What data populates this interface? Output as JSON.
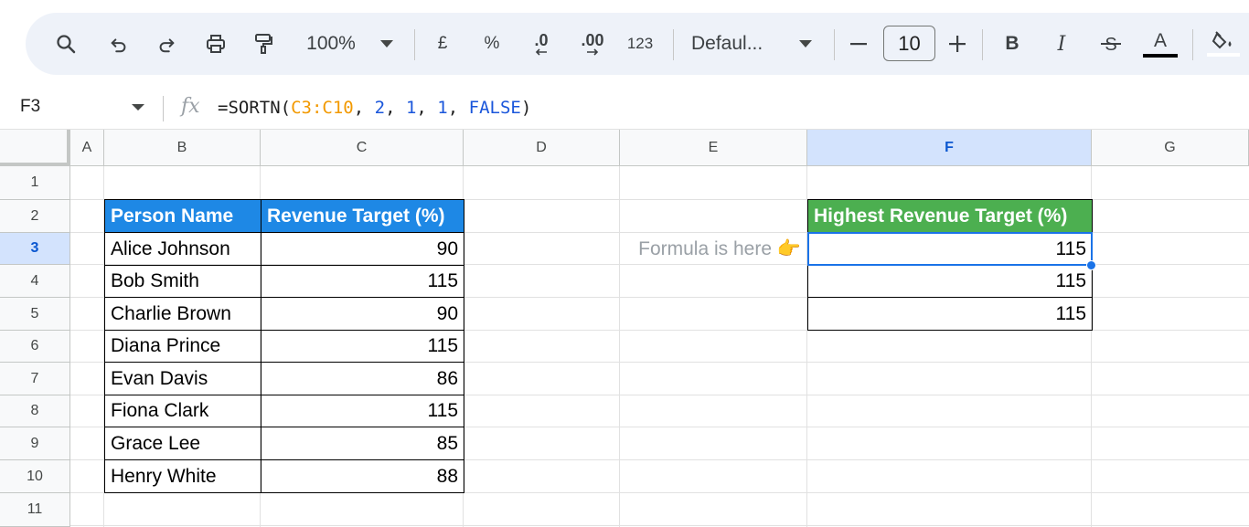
{
  "toolbar": {
    "zoom": "100%",
    "currency": "£",
    "percent": "%",
    "decrease_decimal": ".0",
    "increase_decimal": ".00",
    "number_format": "123",
    "font_name": "Defaul...",
    "font_size": "10",
    "bold": "B",
    "italic": "I",
    "text_color_letter": "A",
    "icons": [
      "search-icon",
      "undo-icon",
      "redo-icon",
      "print-icon",
      "paint-format-icon",
      "minus-icon",
      "plus-icon",
      "strikethrough-icon",
      "fill-color-icon"
    ]
  },
  "formula_bar": {
    "cell_ref": "F3",
    "fx": "fx",
    "formula_prefix": "=SORTN(",
    "formula_range": "C3:C10",
    "formula_sep1": ", ",
    "formula_arg2": "2",
    "formula_sep2": ", ",
    "formula_arg3": "1",
    "formula_sep3": ", ",
    "formula_arg4": "1",
    "formula_sep4": ", ",
    "formula_arg5": "FALSE",
    "formula_suffix": ")"
  },
  "sheet": {
    "columns": [
      "A",
      "B",
      "C",
      "D",
      "E",
      "F",
      "G"
    ],
    "rows": [
      "1",
      "2",
      "3",
      "4",
      "5",
      "6",
      "7",
      "8",
      "9",
      "10",
      "11"
    ],
    "active_column": "F",
    "active_row": "3",
    "table1": {
      "headers": [
        "Person Name",
        "Revenue Target (%)"
      ],
      "rows": [
        [
          "Alice Johnson",
          "90"
        ],
        [
          "Bob Smith",
          "115"
        ],
        [
          "Charlie Brown",
          "90"
        ],
        [
          "Diana Prince",
          "115"
        ],
        [
          "Evan Davis",
          "86"
        ],
        [
          "Fiona Clark",
          "115"
        ],
        [
          "Grace Lee",
          "85"
        ],
        [
          "Henry White",
          "88"
        ]
      ]
    },
    "note": "Formula is here 👉",
    "table2": {
      "header": "Highest Revenue Target (%)",
      "values": [
        "115",
        "115",
        "115"
      ]
    }
  },
  "colors": {
    "header_blue": "#1e88e5",
    "header_green": "#4caf50",
    "selection": "#1a73e8",
    "formula_range": "#f29900",
    "formula_number": "#1a56db"
  }
}
